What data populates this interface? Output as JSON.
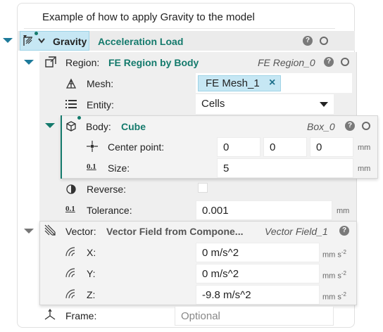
{
  "description": "Example of how to apply Gravity to the model",
  "gravity": {
    "label": "Gravity",
    "type": "Acceleration Load",
    "help": "?"
  },
  "region": {
    "label": "Region:",
    "type": "FE Region by Body",
    "ref": "FE Region_0",
    "help": "?",
    "mesh": {
      "label": "Mesh:",
      "value": "FE Mesh_1",
      "clear": "×"
    },
    "entity": {
      "label": "Entity:",
      "value": "Cells"
    },
    "body": {
      "label": "Body:",
      "type": "Cube",
      "ref": "Box_0",
      "help": "?",
      "center_point": {
        "label": "Center point:",
        "values": [
          "0",
          "0",
          "0"
        ],
        "unit": "mm"
      },
      "size": {
        "label": "Size:",
        "value": "5",
        "unit": "mm"
      }
    },
    "reverse": {
      "label": "Reverse:",
      "checked": false
    },
    "tolerance": {
      "label": "Tolerance:",
      "value": "0.001",
      "unit": "mm"
    }
  },
  "vector": {
    "label": "Vector:",
    "type": "Vector Field from Compone...",
    "ref": "Vector Field_1",
    "help": "?",
    "x": {
      "label": "X:",
      "value": "0 m/s^2"
    },
    "y": {
      "label": "Y:",
      "value": "0 m/s^2"
    },
    "z": {
      "label": "Z:",
      "value": "-9.8 m/s^2"
    },
    "unit": "mm s",
    "unit_exp": "-2"
  },
  "frame": {
    "label": "Frame:",
    "placeholder": "Optional"
  },
  "size_icon_text": "0.1",
  "colors": {
    "accent": "#147a6c",
    "selected": "#c6e7f4",
    "panel": "#eaeaea",
    "section": "#efefef"
  }
}
